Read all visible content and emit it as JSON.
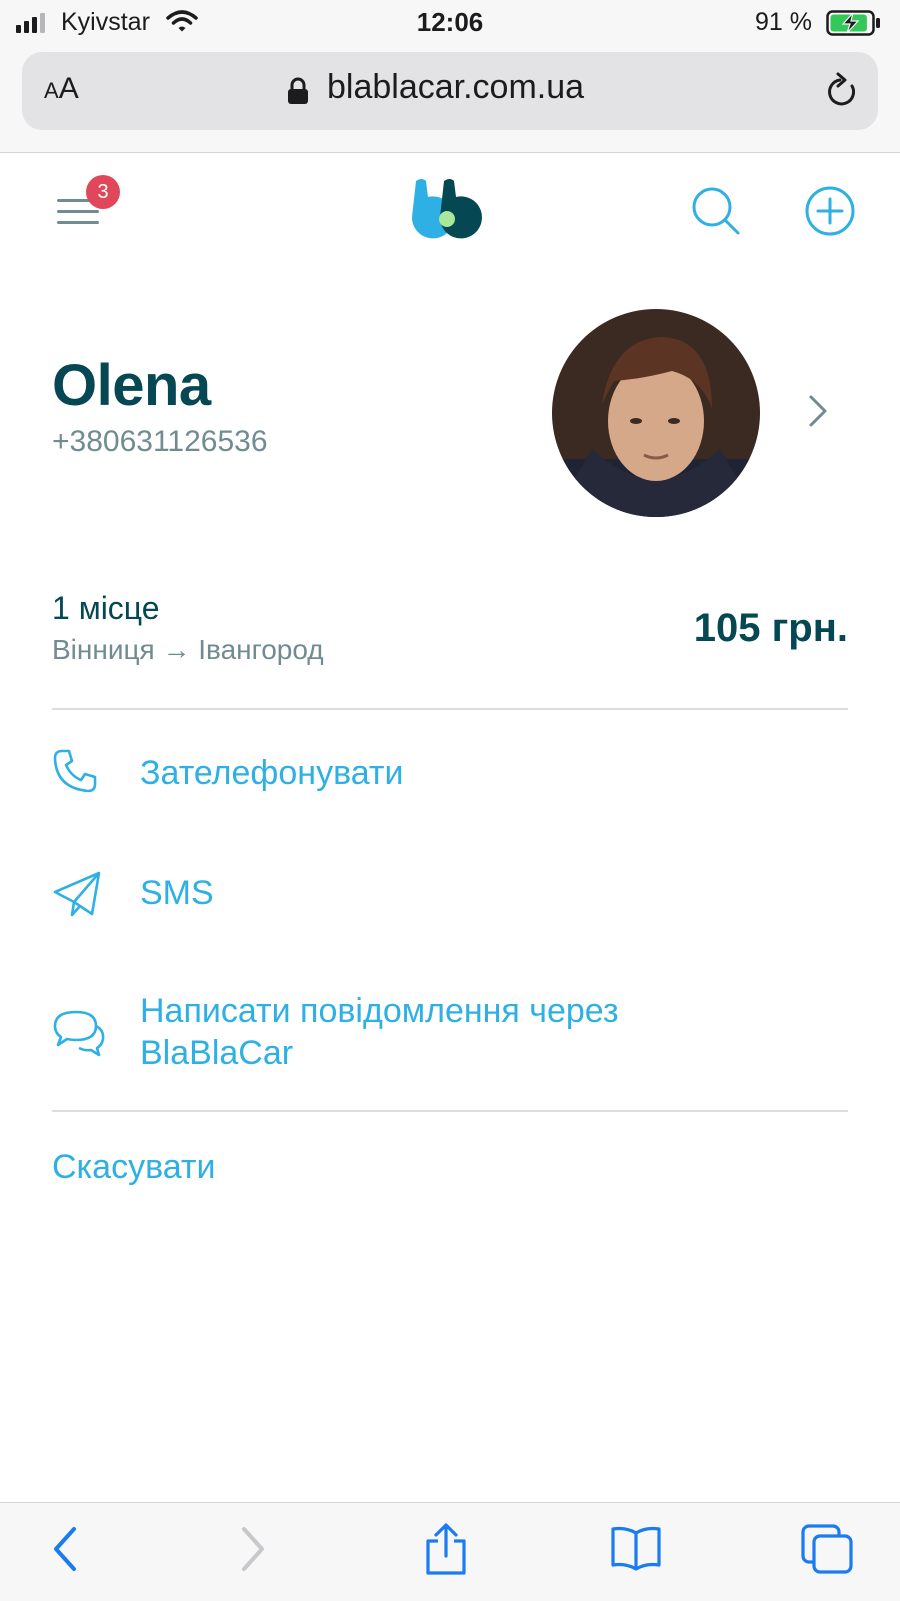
{
  "status_bar": {
    "carrier": "Kyivstar",
    "time": "12:06",
    "battery_percent": "91 %",
    "battery_level": 0.91,
    "signal_bars": 3,
    "signal_max": 4
  },
  "browser": {
    "text_size_small": "A",
    "text_size_large": "A",
    "url": "blablacar.com.ua"
  },
  "header": {
    "menu_badge": "3"
  },
  "driver": {
    "name": "Olena",
    "phone": "+380631126536"
  },
  "trip": {
    "seats": "1 місце",
    "from": "Вінниця",
    "arrow": "→",
    "to": "Івангород",
    "price": "105 грн."
  },
  "actions": {
    "call": "Зателефонувати",
    "sms": "SMS",
    "message_line1": "Написати повідомлення через",
    "message_line2": "BlaBlaCar",
    "cancel": "Скасувати"
  },
  "colors": {
    "brand_dark": "#054752",
    "brand_blue": "#2eb0e5",
    "muted": "#708c91",
    "badge": "#e0475a",
    "ios_blue": "#1a7cf0"
  }
}
